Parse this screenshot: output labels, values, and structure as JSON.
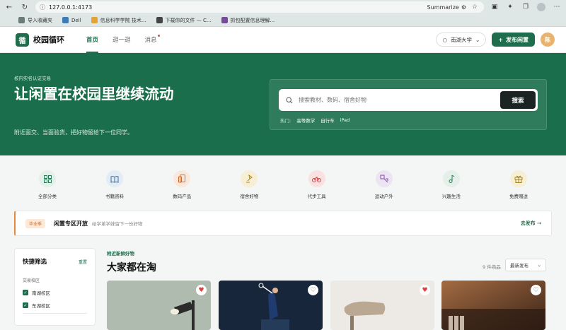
{
  "browser": {
    "url": "127.0.0.1:4173",
    "summarize_label": "Summarize",
    "bookmarks": [
      {
        "label": "导入收藏夹",
        "color": "#6c7a7a"
      },
      {
        "label": "Dell",
        "color": "#3f7ab8"
      },
      {
        "label": "信息科学学院 技术...",
        "color": "#e3a332"
      },
      {
        "label": "下载你的文件 — C...",
        "color": "#444"
      },
      {
        "label": "抓包配置信息理解...",
        "color": "#7a4a9a"
      }
    ]
  },
  "app": {
    "logo_char": "循",
    "name": "校园循环",
    "nav": [
      {
        "label": "首页",
        "active": true
      },
      {
        "label": "逛一逛",
        "active": false
      },
      {
        "label": "消息",
        "active": false,
        "badge": true
      }
    ],
    "campus": "南湖大学",
    "publish_label": "发布闲置",
    "user_initial": "陈"
  },
  "hero": {
    "eyebrow": "校内实名认证交易",
    "title": "让闲置在校园里继续流动",
    "subtitle": "附近面交、当面验货，把好物留给下一位同学。",
    "search_placeholder": "搜索教材、数码、宿舍好物",
    "search_button": "搜索",
    "hot_label": "热门:",
    "hot_tags": [
      "高等数学",
      "自行车",
      "iPad"
    ]
  },
  "categories": [
    {
      "label": "全部分类",
      "icon": "grid-icon",
      "bg": "#e3efe8",
      "fg": "#2e7a56"
    },
    {
      "label": "书籍资料",
      "icon": "book-icon",
      "bg": "#e3ecf5",
      "fg": "#3a6ea5"
    },
    {
      "label": "数码产品",
      "icon": "device-icon",
      "bg": "#fbe8dc",
      "fg": "#cc6a33"
    },
    {
      "label": "宿舍好物",
      "icon": "lamp-icon",
      "bg": "#f6efd6",
      "fg": "#a58424"
    },
    {
      "label": "代步工具",
      "icon": "bike-icon",
      "bg": "#f9e1e1",
      "fg": "#c64848"
    },
    {
      "label": "运动户外",
      "icon": "sport-icon",
      "bg": "#ede4f3",
      "fg": "#7a4fa0"
    },
    {
      "label": "兴趣生活",
      "icon": "music-icon",
      "bg": "#e3efe8",
      "fg": "#2e7a56"
    },
    {
      "label": "免费赠送",
      "icon": "gift-icon",
      "bg": "#f6efd6",
      "fg": "#a58424"
    }
  ],
  "notice": {
    "tag": "毕业季",
    "title": "闲置专区开放",
    "desc": "给学弟学妹留下一份好物",
    "link": "去发布 →"
  },
  "sidebar": {
    "title": "快捷筛选",
    "reset": "重置",
    "section_label": "交易校区",
    "campuses": [
      "南湖校区",
      "东湖校区"
    ]
  },
  "feed": {
    "eyebrow": "附近新鲜好物",
    "title": "大家都在淘",
    "count": "9 件商品",
    "sort": "最新发布",
    "cards": [
      {
        "bg": "#a7b3a8",
        "liked": true
      },
      {
        "bg": "#1b2b3e",
        "liked": false
      },
      {
        "bg": "#ece8e4",
        "liked": true
      },
      {
        "bg": "#5b3b28",
        "liked": false
      }
    ]
  }
}
